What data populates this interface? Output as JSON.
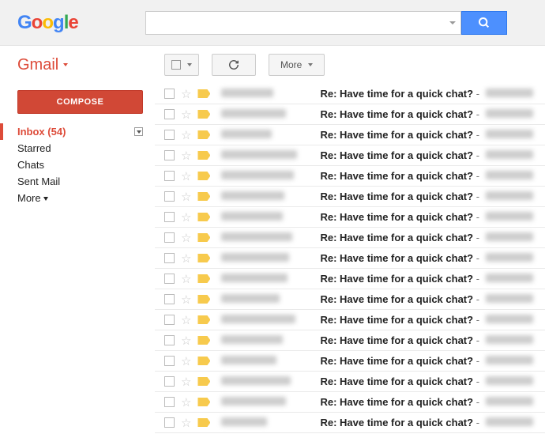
{
  "header": {
    "logo": "Google",
    "search_placeholder": ""
  },
  "app": {
    "title": "Gmail"
  },
  "toolbar": {
    "more_label": "More"
  },
  "sidebar": {
    "compose_label": "COMPOSE",
    "items": [
      {
        "label": "Inbox",
        "count": "(54)",
        "active": true,
        "has_dd": true
      },
      {
        "label": "Starred"
      },
      {
        "label": "Chats"
      },
      {
        "label": "Sent Mail"
      },
      {
        "label": "More",
        "has_caret": true
      }
    ]
  },
  "mail": {
    "subject": "Re: Have time for a quick chat?",
    "separator": " -",
    "rows": [
      {
        "sender_w": 66
      },
      {
        "sender_w": 82
      },
      {
        "sender_w": 64
      },
      {
        "sender_w": 96
      },
      {
        "sender_w": 92
      },
      {
        "sender_w": 80
      },
      {
        "sender_w": 78
      },
      {
        "sender_w": 90
      },
      {
        "sender_w": 86
      },
      {
        "sender_w": 84
      },
      {
        "sender_w": 74
      },
      {
        "sender_w": 94
      },
      {
        "sender_w": 78
      },
      {
        "sender_w": 70
      },
      {
        "sender_w": 88
      },
      {
        "sender_w": 82
      },
      {
        "sender_w": 58
      }
    ]
  }
}
